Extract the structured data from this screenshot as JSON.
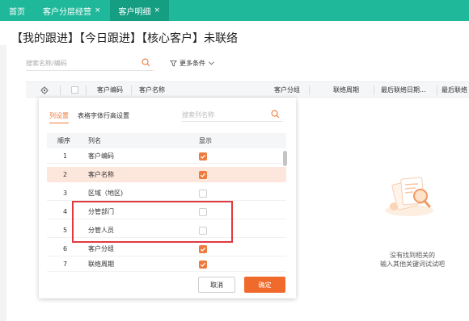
{
  "tabs": [
    {
      "label": "首页",
      "closable": false,
      "active": false
    },
    {
      "label": "客户分层经营",
      "closable": true,
      "active": false
    },
    {
      "label": "客户明细",
      "closable": true,
      "active": true
    }
  ],
  "tab_close_symbol": "×",
  "page_title": "【我的跟进】【今日跟进】【核心客户】未联络",
  "search": {
    "placeholder": "搜索名称/编码",
    "value": ""
  },
  "more_filters_label": "更多条件",
  "table_headers": {
    "code": "客户编码",
    "name": "客户名称",
    "group": "客户分组",
    "cycle": "联络周期",
    "last_date": "最后联络日期...",
    "last_contact": "最后联络"
  },
  "column_panel": {
    "tabs": [
      "列设置",
      "表格字体行高设置"
    ],
    "search_placeholder": "搜索列名称",
    "headers": {
      "order": "顺序",
      "name": "列名",
      "show": "显示"
    },
    "rows": [
      {
        "order": "1",
        "name": "客户编码",
        "show": true
      },
      {
        "order": "2",
        "name": "客户名称",
        "show": true
      },
      {
        "order": "3",
        "name": "区域（地区)",
        "show": false
      },
      {
        "order": "4",
        "name": "分管部门",
        "show": false
      },
      {
        "order": "5",
        "name": "分管人员",
        "show": false
      },
      {
        "order": "6",
        "name": "客户分组",
        "show": true
      },
      {
        "order": "7",
        "name": "联络周期",
        "show": true
      }
    ],
    "cancel_label": "取消",
    "confirm_label": "确定"
  },
  "empty_state": {
    "line1": "没有找到相关的",
    "line2": "输入其他关键词试试吧"
  },
  "colors": {
    "brand": "#1fb89a",
    "accent": "#f06a2c",
    "highlight": "#e0393e"
  }
}
